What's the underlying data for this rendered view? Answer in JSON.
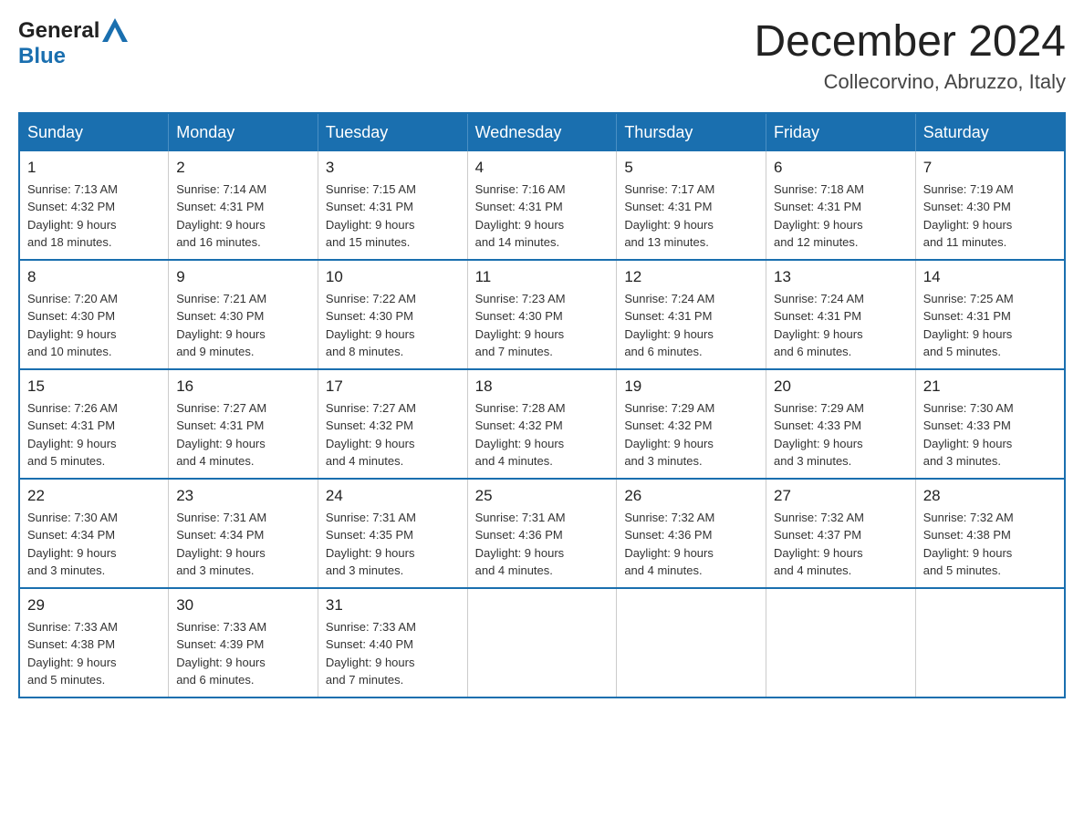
{
  "header": {
    "logo": {
      "general": "General",
      "blue": "Blue",
      "triangle_title": "GeneralBlue logo"
    },
    "title": "December 2024",
    "location": "Collecorvino, Abruzzo, Italy"
  },
  "calendar": {
    "days_of_week": [
      "Sunday",
      "Monday",
      "Tuesday",
      "Wednesday",
      "Thursday",
      "Friday",
      "Saturday"
    ],
    "weeks": [
      [
        {
          "day": "1",
          "sunrise": "7:13 AM",
          "sunset": "4:32 PM",
          "daylight": "9 hours and 18 minutes."
        },
        {
          "day": "2",
          "sunrise": "7:14 AM",
          "sunset": "4:31 PM",
          "daylight": "9 hours and 16 minutes."
        },
        {
          "day": "3",
          "sunrise": "7:15 AM",
          "sunset": "4:31 PM",
          "daylight": "9 hours and 15 minutes."
        },
        {
          "day": "4",
          "sunrise": "7:16 AM",
          "sunset": "4:31 PM",
          "daylight": "9 hours and 14 minutes."
        },
        {
          "day": "5",
          "sunrise": "7:17 AM",
          "sunset": "4:31 PM",
          "daylight": "9 hours and 13 minutes."
        },
        {
          "day": "6",
          "sunrise": "7:18 AM",
          "sunset": "4:31 PM",
          "daylight": "9 hours and 12 minutes."
        },
        {
          "day": "7",
          "sunrise": "7:19 AM",
          "sunset": "4:30 PM",
          "daylight": "9 hours and 11 minutes."
        }
      ],
      [
        {
          "day": "8",
          "sunrise": "7:20 AM",
          "sunset": "4:30 PM",
          "daylight": "9 hours and 10 minutes."
        },
        {
          "day": "9",
          "sunrise": "7:21 AM",
          "sunset": "4:30 PM",
          "daylight": "9 hours and 9 minutes."
        },
        {
          "day": "10",
          "sunrise": "7:22 AM",
          "sunset": "4:30 PM",
          "daylight": "9 hours and 8 minutes."
        },
        {
          "day": "11",
          "sunrise": "7:23 AM",
          "sunset": "4:30 PM",
          "daylight": "9 hours and 7 minutes."
        },
        {
          "day": "12",
          "sunrise": "7:24 AM",
          "sunset": "4:31 PM",
          "daylight": "9 hours and 6 minutes."
        },
        {
          "day": "13",
          "sunrise": "7:24 AM",
          "sunset": "4:31 PM",
          "daylight": "9 hours and 6 minutes."
        },
        {
          "day": "14",
          "sunrise": "7:25 AM",
          "sunset": "4:31 PM",
          "daylight": "9 hours and 5 minutes."
        }
      ],
      [
        {
          "day": "15",
          "sunrise": "7:26 AM",
          "sunset": "4:31 PM",
          "daylight": "9 hours and 5 minutes."
        },
        {
          "day": "16",
          "sunrise": "7:27 AM",
          "sunset": "4:31 PM",
          "daylight": "9 hours and 4 minutes."
        },
        {
          "day": "17",
          "sunrise": "7:27 AM",
          "sunset": "4:32 PM",
          "daylight": "9 hours and 4 minutes."
        },
        {
          "day": "18",
          "sunrise": "7:28 AM",
          "sunset": "4:32 PM",
          "daylight": "9 hours and 4 minutes."
        },
        {
          "day": "19",
          "sunrise": "7:29 AM",
          "sunset": "4:32 PM",
          "daylight": "9 hours and 3 minutes."
        },
        {
          "day": "20",
          "sunrise": "7:29 AM",
          "sunset": "4:33 PM",
          "daylight": "9 hours and 3 minutes."
        },
        {
          "day": "21",
          "sunrise": "7:30 AM",
          "sunset": "4:33 PM",
          "daylight": "9 hours and 3 minutes."
        }
      ],
      [
        {
          "day": "22",
          "sunrise": "7:30 AM",
          "sunset": "4:34 PM",
          "daylight": "9 hours and 3 minutes."
        },
        {
          "day": "23",
          "sunrise": "7:31 AM",
          "sunset": "4:34 PM",
          "daylight": "9 hours and 3 minutes."
        },
        {
          "day": "24",
          "sunrise": "7:31 AM",
          "sunset": "4:35 PM",
          "daylight": "9 hours and 3 minutes."
        },
        {
          "day": "25",
          "sunrise": "7:31 AM",
          "sunset": "4:36 PM",
          "daylight": "9 hours and 4 minutes."
        },
        {
          "day": "26",
          "sunrise": "7:32 AM",
          "sunset": "4:36 PM",
          "daylight": "9 hours and 4 minutes."
        },
        {
          "day": "27",
          "sunrise": "7:32 AM",
          "sunset": "4:37 PM",
          "daylight": "9 hours and 4 minutes."
        },
        {
          "day": "28",
          "sunrise": "7:32 AM",
          "sunset": "4:38 PM",
          "daylight": "9 hours and 5 minutes."
        }
      ],
      [
        {
          "day": "29",
          "sunrise": "7:33 AM",
          "sunset": "4:38 PM",
          "daylight": "9 hours and 5 minutes."
        },
        {
          "day": "30",
          "sunrise": "7:33 AM",
          "sunset": "4:39 PM",
          "daylight": "9 hours and 6 minutes."
        },
        {
          "day": "31",
          "sunrise": "7:33 AM",
          "sunset": "4:40 PM",
          "daylight": "9 hours and 7 minutes."
        },
        null,
        null,
        null,
        null
      ]
    ]
  }
}
